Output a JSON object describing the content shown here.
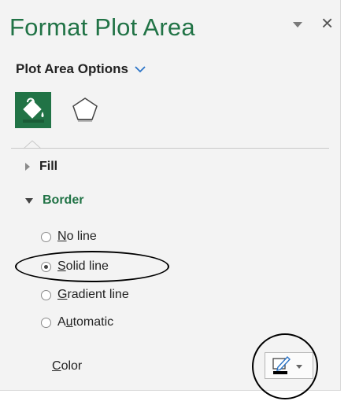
{
  "pane": {
    "title": "Format Plot Area",
    "close_glyph": "×",
    "dropdown_icon": "caret-down-icon"
  },
  "options": {
    "label": "Plot Area Options",
    "chevron_icon": "chevron-down-icon",
    "tabs": [
      {
        "name": "fill-and-line",
        "icon": "paint-bucket-icon",
        "selected": true
      },
      {
        "name": "effects",
        "icon": "pentagon-icon",
        "selected": false
      }
    ]
  },
  "sections": {
    "fill": {
      "label": "Fill",
      "expanded": false
    },
    "border": {
      "label": "Border",
      "expanded": true
    }
  },
  "border_options": [
    {
      "access_key": "N",
      "rest": "o line",
      "checked": false
    },
    {
      "access_key": "S",
      "rest": "olid line",
      "checked": true
    },
    {
      "access_key": "G",
      "rest": "radient line",
      "checked": false
    },
    {
      "prefix": "A",
      "access_key": "u",
      "rest": "tomatic",
      "checked": false
    }
  ],
  "color": {
    "prefix": "",
    "access_key": "C",
    "rest": "olor",
    "button_icon": "pen-color-icon",
    "swatch_color": "#000000"
  },
  "colors": {
    "accent": "#217346",
    "pane_bg": "#f3f3f3"
  }
}
